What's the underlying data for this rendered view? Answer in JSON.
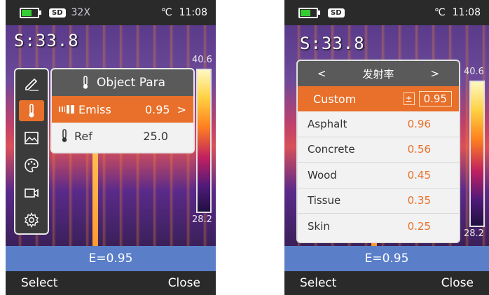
{
  "left": {
    "status": {
      "sd": "SD",
      "zoom": "32X",
      "unit": "℃",
      "time": "11:08"
    },
    "spot": "S:33.8",
    "scale": {
      "max": "40.6",
      "min": "28.2"
    },
    "menu_rail": [
      "edit-icon",
      "thermometer-icon",
      "image-icon",
      "palette-icon",
      "video-icon",
      "gear-icon"
    ],
    "panel": {
      "title": "Object Para",
      "rows": [
        {
          "label": "Emiss",
          "value": "0.95",
          "arrow": ">"
        },
        {
          "label": "Ref",
          "value": "25.0"
        }
      ]
    },
    "emissivity_bar": "E=0.95",
    "softkeys": {
      "left": "Select",
      "right": "Close"
    }
  },
  "right": {
    "status": {
      "sd": "SD",
      "unit": "℃",
      "time": "11:08"
    },
    "spot": "S:33.8",
    "scale": {
      "max": "40.6",
      "min": "28.2"
    },
    "panel": {
      "title": "发射率",
      "prev": "<",
      "next": ">",
      "custom": {
        "label": "Custom",
        "pm": "±",
        "value": "0.95"
      },
      "materials": [
        {
          "name": "Asphalt",
          "value": "0.96"
        },
        {
          "name": "Concrete",
          "value": "0.56"
        },
        {
          "name": "Wood",
          "value": "0.45"
        },
        {
          "name": "Tissue",
          "value": "0.35"
        },
        {
          "name": "Skin",
          "value": "0.25"
        }
      ]
    },
    "emissivity_bar": "E=0.95",
    "softkeys": {
      "left": "Select",
      "right": "Close"
    }
  },
  "colors": {
    "accent": "#e8702a",
    "ebar": "#5a7fc8",
    "header": "#5a5a5a"
  }
}
